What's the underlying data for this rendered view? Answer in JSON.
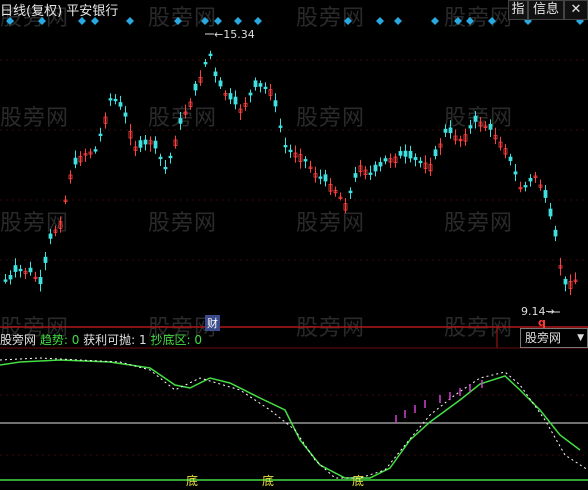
{
  "header": {
    "title": "日线(复权) 平安银行",
    "btn_zhi": "指",
    "btn_info": "信息"
  },
  "main_chart": {
    "high_label": "15.34",
    "low_label": "9.14",
    "cai_marker": "财",
    "q_marker": "q",
    "candle_up_color": "#ff4040",
    "candle_down_color": "#40e0e0",
    "diamond_color": "#2aa8e0"
  },
  "indicator": {
    "name": "股旁网",
    "label_trend": "趋势: 0",
    "label_profit": "获利可抛: 1",
    "label_bottom": "抄底区: 0",
    "dropdown_value": "股旁网",
    "bottom_marks": [
      "底",
      "底",
      "底"
    ],
    "line_color": "#44dd44"
  },
  "watermarks": [
    "股旁网",
    "股旁网",
    "股旁网",
    "股旁网",
    "股旁网",
    "股旁网",
    "股旁网",
    "股旁网",
    "股旁网",
    "股旁网",
    "股旁网",
    "股旁网",
    "股旁网",
    "股旁网",
    "股旁网",
    "股旁网"
  ]
}
